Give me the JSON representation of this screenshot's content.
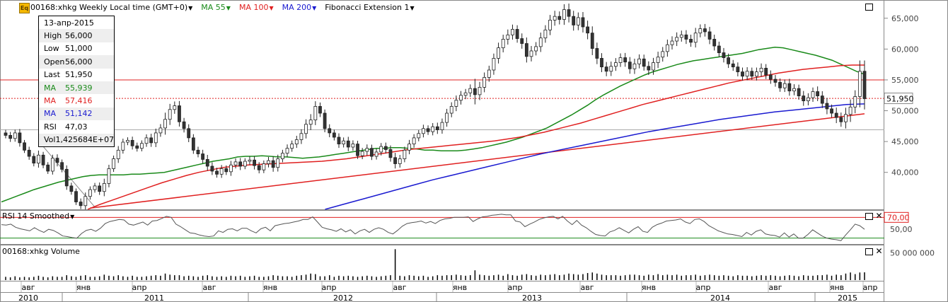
{
  "toolbar": {
    "symbol_icon": "eq-symbol-icon",
    "symbol_label": "00168:xhkg Weekly Local time (GMT+0)",
    "ma55_label": "MA 55",
    "ma100_label": "MA 100",
    "ma200_label": "MA 200",
    "fib_label": "Fibonacci Extension 1",
    "ma55_color": "#1a8a1a",
    "ma100_color": "#e02020",
    "ma200_color": "#1a1ad0"
  },
  "infobox": {
    "date": "13-апр-2015",
    "rows": [
      {
        "k": "High",
        "v": "56,000",
        "color": "#000000"
      },
      {
        "k": "Low",
        "v": "51,000",
        "color": "#000000"
      },
      {
        "k": "Open",
        "v": "56,000",
        "color": "#000000"
      },
      {
        "k": "Last",
        "v": "51,950",
        "color": "#000000"
      },
      {
        "k": "MA",
        "v": "55,939",
        "color": "#1a8a1a"
      },
      {
        "k": "MA",
        "v": "57,416",
        "color": "#e02020"
      },
      {
        "k": "MA",
        "v": "51,142",
        "color": "#1a1ad0"
      },
      {
        "k": "RSI",
        "v": "47,03",
        "color": "#000000"
      },
      {
        "k": "Vol",
        "v": "1,425684E+07",
        "color": "#000000"
      }
    ]
  },
  "rsi_pane": {
    "title": "RSI 14 Smoothed",
    "level_label": "70,00",
    "level_color": "#e02020"
  },
  "volume_pane": {
    "title": "00168:xhkg Volume"
  },
  "chart_data": {
    "type": "candlestick",
    "price_axis": {
      "ticks": [
        "65,000",
        "60,000",
        "55,000",
        "50,000",
        "45,000",
        "40,000"
      ],
      "last_label": "51,950",
      "ylim": [
        34,
        67.5
      ]
    },
    "rsi_axis": {
      "ticks": [
        "70,00",
        "50,00"
      ],
      "ylim": [
        20,
        80
      ]
    },
    "volume_axis": {
      "ticks": [
        "50 000 000"
      ],
      "ylim": [
        0,
        60000000
      ]
    },
    "x_month_labels": [
      "авг",
      "янв",
      "апр",
      "авг",
      "янв",
      "апр",
      "авг",
      "янв",
      "апр",
      "авг",
      "янв",
      "апр",
      "авг",
      "янв",
      "апр"
    ],
    "x_year_labels": [
      "2010",
      "2011",
      "2012",
      "2013",
      "2014",
      "2015"
    ],
    "x_range": [
      "2010-06-01",
      "2015-04-20"
    ],
    "horizontal_lines": [
      {
        "name": "fib-level-55000",
        "y": 55.0,
        "color": "#e02020",
        "style": "solid"
      },
      {
        "name": "fib-level-52000",
        "y": 52.0,
        "color": "#e02020",
        "style": "dotted"
      }
    ],
    "trendlines": [
      {
        "name": "fib-trendline",
        "points": [
          [
            "2010-12-01",
            34.2
          ],
          [
            "2015-04-20",
            49.5
          ]
        ],
        "color": "#e02020"
      },
      {
        "name": "fib-drop-line",
        "points": [
          [
            "2010-08-23",
            44.5
          ],
          [
            "2010-12-13",
            34.2
          ]
        ],
        "color": "#888888"
      }
    ],
    "candles_close": [
      46,
      45.5,
      46.4,
      44.8,
      43.6,
      42.6,
      41.5,
      42.8,
      41.2,
      40.2,
      42.3,
      41.6,
      40.5,
      37.8,
      36.9,
      35.2,
      34.6,
      36.1,
      37.2,
      37.8,
      36.9,
      38.2,
      40.6,
      42.2,
      43.6,
      44.9,
      45.2,
      44.3,
      43.9,
      44.7,
      45.6,
      44.8,
      46.4,
      47.2,
      48.6,
      50.2,
      50.8,
      48.2,
      47.1,
      45.6,
      43.6,
      43.0,
      42.1,
      41.0,
      40.2,
      39.7,
      40.6,
      40.1,
      41.2,
      41.7,
      41.0,
      41.8,
      42.0,
      41.1,
      40.4,
      41.4,
      41.9,
      40.8,
      42.2,
      43.1,
      43.9,
      44.6,
      45.3,
      46.3,
      47.8,
      48.5,
      50.7,
      49.6,
      47.1,
      46.4,
      45.7,
      44.6,
      45.1,
      44.1,
      44.6,
      42.7,
      43.4,
      43.9,
      42.6,
      43.3,
      44.2,
      43.7,
      42.4,
      41.4,
      42.2,
      43.6,
      44.6,
      45.6,
      46.3,
      47.1,
      46.6,
      47.4,
      46.9,
      48.1,
      49.6,
      50.7,
      51.7,
      52.5,
      52.9,
      53.6,
      52.6,
      53.8,
      55.4,
      56.6,
      58.5,
      60.2,
      61.6,
      62.3,
      63.2,
      61.7,
      60.9,
      58.8,
      59.7,
      60.4,
      61.8,
      63.1,
      64.7,
      65.3,
      64.8,
      66.4,
      65.3,
      63.9,
      65.1,
      63.6,
      62.6,
      60.1,
      58.5,
      57.1,
      56.4,
      57.2,
      57.8,
      58.6,
      57.9,
      56.8,
      57.6,
      58.4,
      57.2,
      56.6,
      57.8,
      58.7,
      59.6,
      60.7,
      61.3,
      61.9,
      62.3,
      61.6,
      61.1,
      62.6,
      63.3,
      62.8,
      61.6,
      60.5,
      59.4,
      58.6,
      57.6,
      57.1,
      56.3,
      55.6,
      56.4,
      55.6,
      56.3,
      56.9,
      55.8,
      55.1,
      54.6,
      53.7,
      54.4,
      53.2,
      53.6,
      52.4,
      51.6,
      52.1,
      53.1,
      52.4,
      51.2,
      50.3,
      49.6,
      48.9,
      48.2,
      49.4,
      50.6,
      52.3,
      56.4,
      51.95
    ],
    "candles_range": [
      1.4,
      1.6,
      1.5,
      1.8,
      1.3,
      1.6,
      1.5,
      2.1,
      1.5,
      1.3,
      1.6,
      1.8,
      1.4,
      1.8,
      1.5,
      1.4,
      1.6,
      1.8,
      1.5,
      1.4,
      1.6,
      2.2,
      1.8,
      1.5,
      1.9,
      1.6,
      1.4,
      1.7,
      1.5,
      1.4,
      1.6,
      1.9,
      2.0,
      1.8,
      3.1,
      2.6,
      2.0,
      2.2,
      1.8,
      2.0,
      1.7,
      1.6,
      1.9,
      2.1,
      1.8,
      1.6,
      1.7,
      1.5,
      1.9,
      1.6,
      1.8,
      1.4,
      1.7,
      1.8,
      1.6,
      1.5,
      1.7,
      2.0,
      1.9,
      1.6,
      1.8,
      1.6,
      1.8,
      2.0,
      2.3,
      2.7,
      2.4,
      1.8,
      1.7,
      2.0,
      1.5,
      1.8,
      1.6,
      1.9,
      1.7,
      1.5,
      1.6,
      1.8,
      1.7,
      1.5,
      1.6,
      1.8,
      1.9,
      2.2,
      1.8,
      1.6,
      1.9,
      1.7,
      1.6,
      1.8,
      1.5,
      1.7,
      1.9,
      1.8,
      2.0,
      1.9,
      2.2,
      2.0,
      1.8,
      1.9,
      4.5,
      2.5,
      2.3,
      2.0,
      2.2,
      2.4,
      2.1,
      2.5,
      2.2,
      1.9,
      2.4,
      2.8,
      2.3,
      2.1,
      2.5,
      2.2,
      2.4,
      2.6,
      2.3,
      2.5,
      2.8,
      2.6,
      2.4,
      2.6,
      2.9,
      3.1,
      2.7,
      2.4,
      2.3,
      2.2,
      2.1,
      2.0,
      2.2,
      2.3,
      2.4,
      2.1,
      2.0,
      2.3,
      2.2,
      2.5,
      2.1,
      2.4,
      2.2,
      2.3,
      2.0,
      2.2,
      2.1,
      2.4,
      2.0,
      2.2,
      2.3,
      2.1,
      2.0,
      2.2,
      1.9,
      1.8,
      2.1,
      2.0,
      1.9,
      1.7,
      2.0,
      2.2,
      1.9,
      2.1,
      2.0,
      1.8,
      1.9,
      2.2,
      2.0,
      1.8,
      2.3,
      2.1,
      1.9,
      2.4,
      2.2,
      2.5,
      2.0,
      2.6,
      2.3,
      3.1,
      3.5,
      2.9,
      5.0,
      5.0
    ],
    "ma55": [
      35.2,
      35.7,
      36.2,
      36.7,
      37.2,
      37.6,
      38.0,
      38.4,
      38.7,
      39.0,
      39.3,
      39.5,
      39.6,
      39.6,
      39.6,
      39.6,
      39.7,
      39.7,
      39.8,
      39.9,
      40.0,
      40.3,
      40.6,
      40.9,
      41.2,
      41.5,
      41.8,
      42.0,
      42.2,
      42.5,
      42.6,
      42.6,
      42.7,
      42.6,
      42.5,
      42.5,
      42.4,
      42.3,
      42.4,
      42.5,
      42.7,
      42.9,
      43.1,
      43.3,
      43.5,
      43.7,
      43.9,
      43.9,
      44.0,
      44.0,
      43.9,
      43.8,
      43.6,
      43.6,
      43.5,
      43.5,
      43.5,
      43.6,
      43.8,
      44.0,
      44.3,
      44.6,
      44.9,
      45.3,
      45.7,
      46.2,
      46.7,
      47.2,
      47.9,
      48.6,
      49.3,
      50.1,
      50.9,
      51.8,
      52.6,
      53.3,
      54.0,
      54.6,
      55.2,
      55.8,
      56.3,
      56.7,
      57.1,
      57.5,
      57.8,
      58.1,
      58.3,
      58.5,
      58.7,
      58.9,
      59.1,
      59.3,
      59.6,
      59.9,
      60.1,
      60.3,
      60.2,
      59.9,
      59.6,
      59.3,
      59.0,
      58.6,
      58.2,
      57.6,
      57.0,
      56.4,
      55.9
    ],
    "ma100": [
      34.0,
      34.8,
      35.5,
      36.2,
      36.9,
      37.6,
      38.3,
      38.9,
      39.5,
      40.0,
      40.4,
      40.8,
      41.0,
      41.2,
      41.3,
      41.4,
      41.5,
      41.6,
      41.7,
      41.8,
      42.0,
      42.2,
      42.5,
      42.8,
      43.1,
      43.4,
      43.7,
      43.9,
      44.1,
      44.3,
      44.5,
      44.7,
      44.9,
      45.1,
      45.4,
      45.7,
      46.1,
      46.5,
      47.0,
      47.5,
      48.0,
      48.6,
      49.2,
      49.8,
      50.4,
      51.0,
      51.5,
      52.0,
      52.5,
      53.0,
      53.5,
      54.0,
      54.5,
      54.9,
      55.3,
      55.7,
      56.1,
      56.4,
      56.7,
      56.9,
      57.1,
      57.3,
      57.4,
      57.4
    ],
    "ma200": [
      34.0,
      34.8,
      35.6,
      36.4,
      37.2,
      38.0,
      38.8,
      39.5,
      40.2,
      40.9,
      41.6,
      42.3,
      43.0,
      43.6,
      44.2,
      44.8,
      45.4,
      46.0,
      46.6,
      47.1,
      47.6,
      48.1,
      48.6,
      49.0,
      49.4,
      49.8,
      50.1,
      50.4,
      50.7,
      51.0,
      51.1
    ],
    "rsi": [
      56,
      55,
      57,
      51,
      48,
      46,
      44,
      50,
      45,
      41,
      47,
      45,
      40,
      34,
      33,
      31,
      30,
      39,
      45,
      47,
      43,
      49,
      58,
      62,
      64,
      66,
      65,
      57,
      55,
      58,
      61,
      55,
      63,
      64,
      68,
      72,
      70,
      57,
      52,
      46,
      40,
      39,
      36,
      34,
      33,
      34,
      44,
      41,
      47,
      48,
      44,
      49,
      49,
      44,
      40,
      48,
      51,
      44,
      54,
      56,
      58,
      59,
      61,
      63,
      66,
      66,
      71,
      61,
      51,
      48,
      46,
      43,
      48,
      42,
      46,
      38,
      44,
      47,
      41,
      47,
      50,
      47,
      41,
      38,
      45,
      53,
      58,
      60,
      61,
      63,
      59,
      62,
      58,
      64,
      67,
      68,
      70,
      70,
      70,
      71,
      62,
      67,
      71,
      72,
      74,
      75,
      76,
      75,
      75,
      63,
      61,
      52,
      57,
      61,
      66,
      69,
      71,
      72,
      67,
      72,
      63,
      56,
      64,
      55,
      50,
      43,
      37,
      35,
      34,
      42,
      45,
      50,
      45,
      40,
      47,
      52,
      43,
      41,
      51,
      56,
      59,
      63,
      64,
      65,
      67,
      61,
      58,
      66,
      67,
      62,
      54,
      49,
      44,
      41,
      38,
      37,
      35,
      33,
      41,
      36,
      43,
      46,
      38,
      36,
      35,
      32,
      40,
      32,
      38,
      30,
      30,
      37,
      46,
      40,
      34,
      30,
      28,
      27,
      25,
      36,
      46,
      57,
      54,
      47
    ],
    "volume_millions": [
      6,
      5,
      7,
      5,
      6,
      5,
      6,
      8,
      6,
      5,
      7,
      6,
      6,
      9,
      7,
      6,
      8,
      9,
      6,
      6,
      7,
      10,
      8,
      7,
      9,
      7,
      6,
      8,
      6,
      6,
      7,
      8,
      9,
      8,
      12,
      10,
      9,
      9,
      7,
      8,
      7,
      6,
      8,
      9,
      7,
      6,
      7,
      6,
      8,
      7,
      8,
      6,
      7,
      8,
      6,
      6,
      7,
      9,
      8,
      7,
      7,
      6,
      8,
      9,
      10,
      12,
      11,
      7,
      7,
      9,
      6,
      8,
      7,
      8,
      7,
      6,
      7,
      8,
      7,
      6,
      7,
      8,
      9,
      57,
      8,
      7,
      9,
      8,
      7,
      8,
      6,
      7,
      9,
      8,
      9,
      9,
      10,
      9,
      8,
      9,
      18,
      10,
      9,
      8,
      9,
      10,
      8,
      11,
      9,
      8,
      10,
      11,
      9,
      8,
      10,
      9,
      10,
      11,
      9,
      10,
      12,
      11,
      10,
      11,
      13,
      14,
      12,
      10,
      9,
      9,
      9,
      8,
      9,
      10,
      10,
      9,
      8,
      10,
      9,
      11,
      9,
      10,
      9,
      10,
      8,
      9,
      9,
      10,
      8,
      9,
      10,
      9,
      8,
      9,
      8,
      7,
      9,
      8,
      8,
      7,
      8,
      9,
      8,
      9,
      8,
      7,
      8,
      9,
      8,
      7,
      9,
      8,
      8,
      9,
      9,
      10,
      8,
      10,
      9,
      12,
      14,
      11,
      14,
      14.3
    ]
  }
}
